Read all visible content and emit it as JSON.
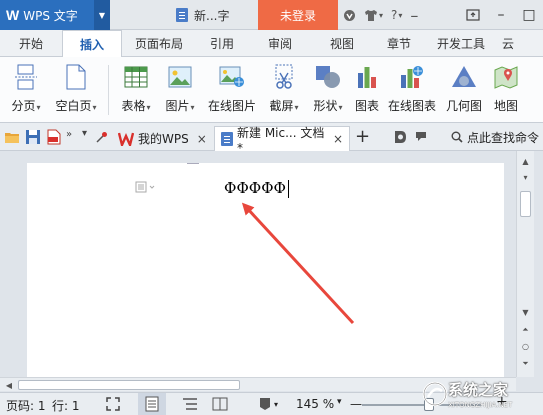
{
  "titlebar": {
    "app_logo": "W",
    "app_name": "WPS 文字",
    "doc_title": "新...字",
    "login_label": "未登录",
    "help_label": "?"
  },
  "ribbon_tabs": [
    "开始",
    "插入",
    "页面布局",
    "引用",
    "审阅",
    "视图",
    "章节",
    "开发工具",
    "云"
  ],
  "active_tab": "插入",
  "ribbon": {
    "page_break": "分页",
    "blank_page": "空白页",
    "table": "表格",
    "picture": "图片",
    "online_picture": "在线图片",
    "screenshot": "截屏",
    "shape": "形状",
    "chart": "图表",
    "online_chart": "在线图表",
    "geometry": "几何图",
    "map": "地图"
  },
  "doc_tabs": {
    "mywps": "我的WPS",
    "current": "新建 Mic... 文档 *",
    "add": "+",
    "search_command": "点此查找命令"
  },
  "document": {
    "text": "ФΦФΦФ"
  },
  "statusbar": {
    "page": "页码: 1",
    "line": "行: 1",
    "zoom": "145 %",
    "minus": "—",
    "plus": "+"
  },
  "watermark": {
    "text": "系统之家",
    "sub": "XITONGZHIJIA.NET"
  },
  "colors": {
    "app_blue": "#2b6fbe",
    "login_orange": "#ef6a45",
    "arrow_red": "#e8473c",
    "wps_red": "#d9302c"
  }
}
